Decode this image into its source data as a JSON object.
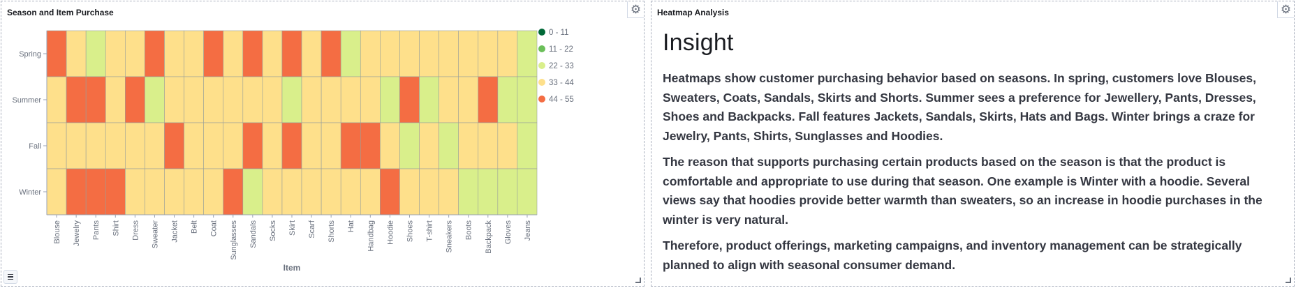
{
  "panels": {
    "left": {
      "title": "Season and Item Purchase"
    },
    "right": {
      "title": "Heatmap Analysis",
      "heading": "Insight",
      "paragraphs": [
        "Heatmaps show customer purchasing behavior based on seasons. In spring, customers love Blouses, Sweaters, Coats, Sandals, Skirts and Shorts. Summer sees a preference for Jewellery, Pants, Dresses, Shoes and Backpacks. Fall features Jackets, Sandals, Skirts, Hats and Bags. Winter brings a craze for Jewelry, Pants, Shirts, Sunglasses and Hoodies.",
        "The reason that supports purchasing certain products based on the season is that the product is comfortable and appropriate to use during that season. One example is Winter with a hoodie. Several views say that hoodies provide better warmth than sweaters, so an increase in hoodie purchases in the winter is very natural.",
        "Therefore, product offerings, marketing campaigns, and inventory management can be strategically planned to align with seasonal consumer demand."
      ]
    }
  },
  "icons": {
    "settings": "gear-icon",
    "legend_toggle": "list-icon",
    "resize": "resize-handle-icon"
  },
  "chart_data": {
    "type": "heatmap",
    "xlabel": "Item",
    "ylabel": "",
    "x": [
      "Blouse",
      "Jewelry",
      "Pants",
      "Shirt",
      "Dress",
      "Sweater",
      "Jacket",
      "Belt",
      "Coat",
      "Sunglasses",
      "Sandals",
      "Socks",
      "Skirt",
      "Scarf",
      "Shorts",
      "Hat",
      "Handbag",
      "Hoodie",
      "Shoes",
      "T-shirt",
      "Sneakers",
      "Boots",
      "Backpack",
      "Gloves",
      "Jeans"
    ],
    "y": [
      "Spring",
      "Summer",
      "Fall",
      "Winter"
    ],
    "legend": {
      "position": "right",
      "bins": [
        {
          "label": "0 - 11",
          "color": "#006837"
        },
        {
          "label": "11 - 22",
          "color": "#6bbf59"
        },
        {
          "label": "22 - 33",
          "color": "#d9ef8b"
        },
        {
          "label": "33 - 44",
          "color": "#fee08b"
        },
        {
          "label": "44 - 55",
          "color": "#f46d43"
        }
      ]
    },
    "bins": [
      [
        4,
        3,
        2,
        3,
        3,
        4,
        3,
        3,
        4,
        3,
        4,
        3,
        4,
        3,
        4,
        2,
        3,
        3,
        3,
        3,
        3,
        3,
        3,
        3,
        2
      ],
      [
        3,
        4,
        4,
        3,
        4,
        2,
        3,
        3,
        3,
        3,
        3,
        3,
        2,
        3,
        3,
        3,
        3,
        2,
        4,
        2,
        3,
        3,
        4,
        2,
        2
      ],
      [
        3,
        3,
        3,
        3,
        3,
        3,
        4,
        3,
        3,
        3,
        4,
        3,
        4,
        3,
        3,
        4,
        4,
        3,
        2,
        3,
        2,
        3,
        3,
        3,
        2
      ],
      [
        3,
        4,
        4,
        4,
        3,
        3,
        3,
        3,
        3,
        4,
        2,
        3,
        3,
        3,
        3,
        3,
        3,
        4,
        3,
        3,
        3,
        2,
        2,
        2,
        2
      ]
    ]
  }
}
